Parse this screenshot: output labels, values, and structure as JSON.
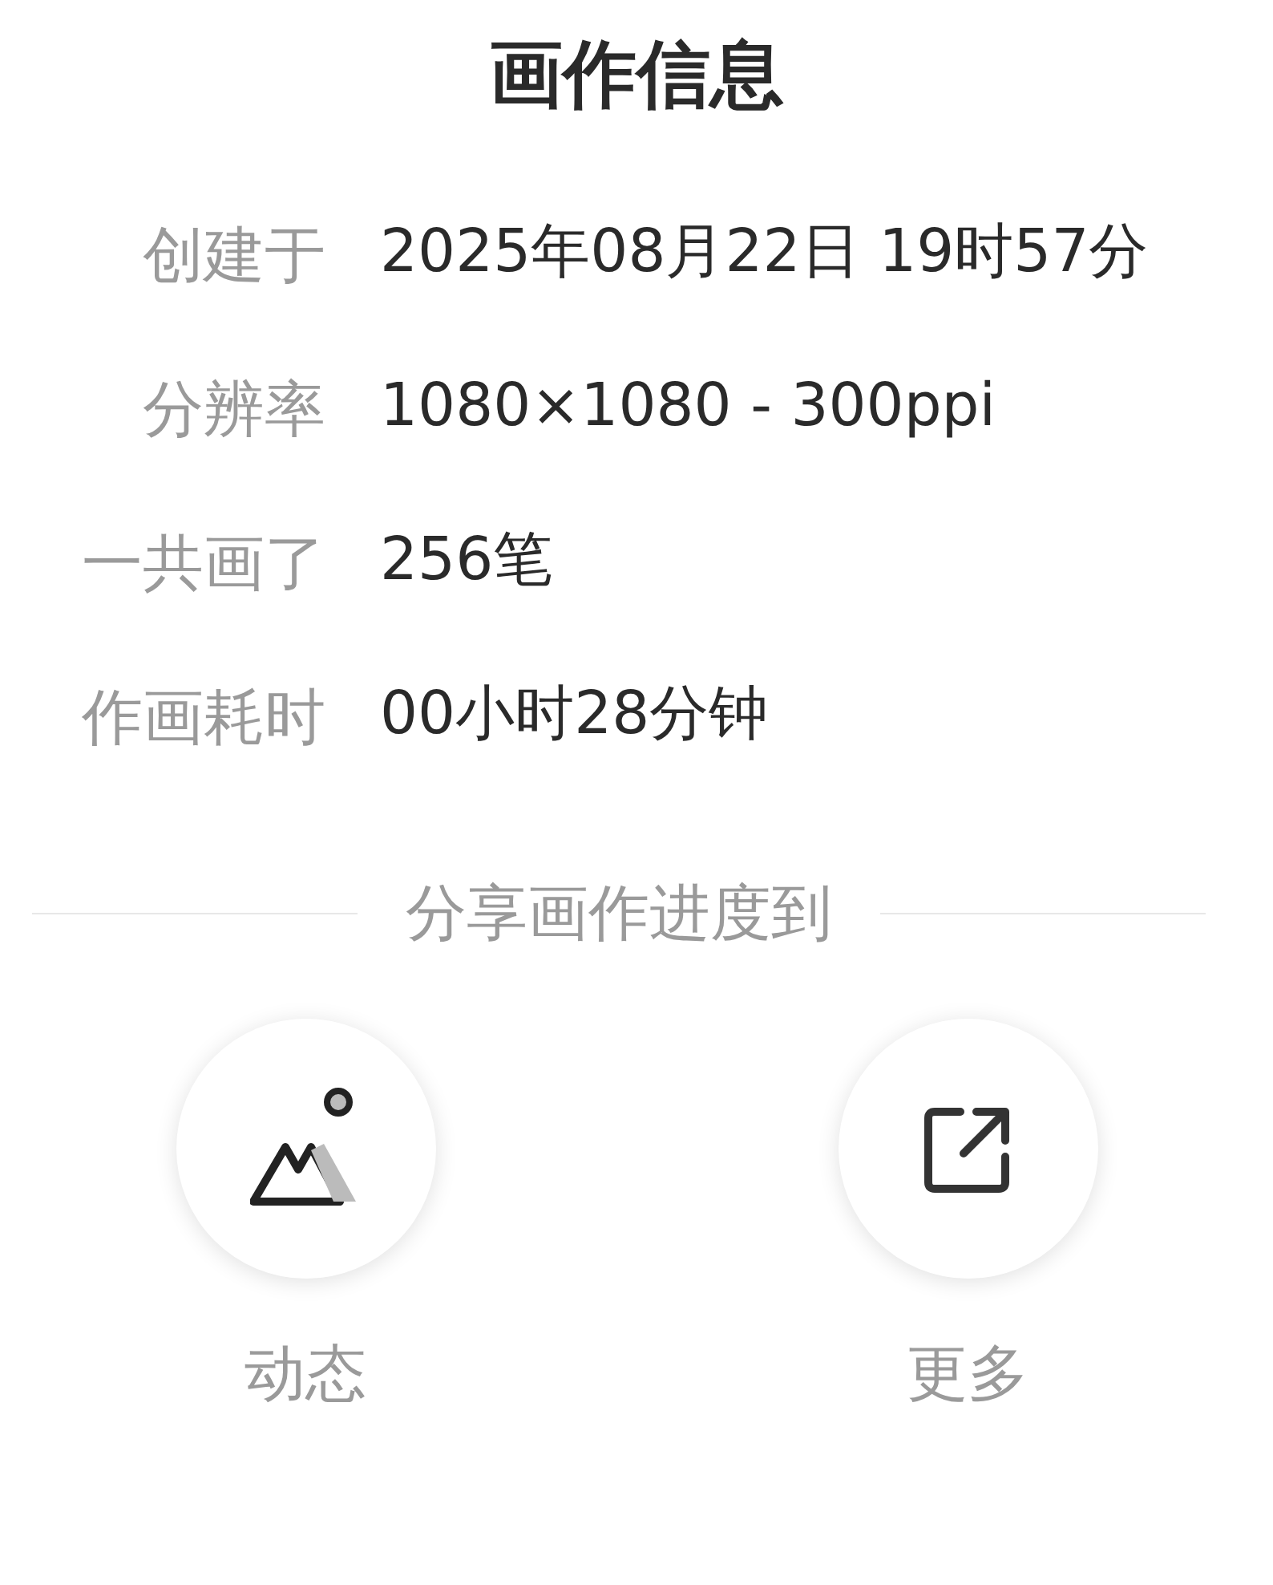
{
  "title": "画作信息",
  "info": [
    {
      "label": "创建于",
      "value": "2025年08月22日 19时57分"
    },
    {
      "label": "分辨率",
      "value": "1080×1080 - 300ppi"
    },
    {
      "label": "一共画了",
      "value": "256笔"
    },
    {
      "label": "作画耗时",
      "value": "00小时28分钟"
    }
  ],
  "share_heading": "分享画作进度到",
  "share_targets": [
    {
      "kind": "moments",
      "label": "动态"
    },
    {
      "kind": "more",
      "label": "更多"
    }
  ]
}
